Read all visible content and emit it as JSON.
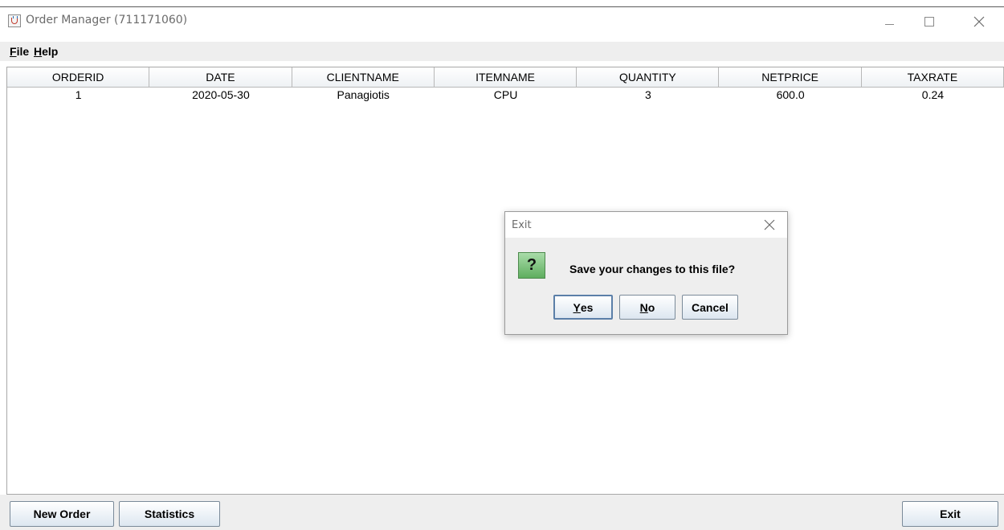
{
  "window": {
    "title": "Order Manager (711171060)"
  },
  "menu": {
    "file_mnemonic": "F",
    "file_rest": "ile",
    "help_mnemonic": "H",
    "help_rest": "elp"
  },
  "table": {
    "columns": [
      "ORDERID",
      "DATE",
      "CLIENTNAME",
      "ITEMNAME",
      "QUANTITY",
      "NETPRICE",
      "TAXRATE"
    ],
    "rows": [
      [
        "1",
        "2020-05-30",
        "Panagiotis",
        "CPU",
        "3",
        "600.0",
        "0.24"
      ]
    ]
  },
  "buttons": {
    "new_order": "New Order",
    "statistics": "Statistics",
    "exit": "Exit"
  },
  "dialog": {
    "title": "Exit",
    "icon_glyph": "?",
    "message": "Save your changes to this file?",
    "yes_mnemonic": "Y",
    "yes_rest": "es",
    "no_mnemonic": "N",
    "no_rest": "o",
    "cancel": "Cancel"
  },
  "icons": {
    "app": "java-coffee-cup-icon",
    "minimize": "minimize-icon",
    "maximize": "maximize-icon",
    "close": "close-icon",
    "question": "question-icon"
  }
}
